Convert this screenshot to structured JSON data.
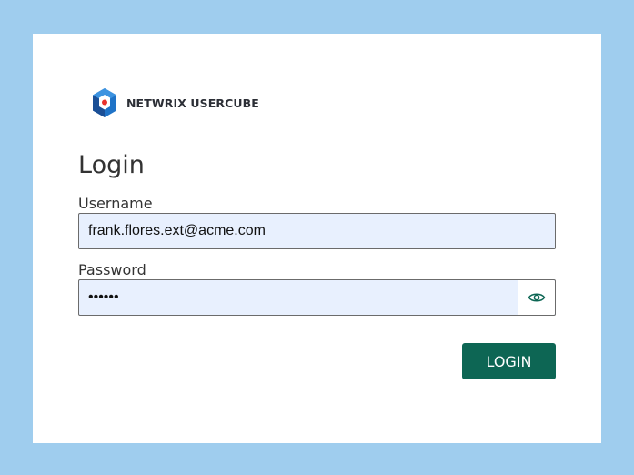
{
  "brand": {
    "name": "NETWRIX USERCUBE",
    "logo_icon": "netwrix-usercube-logo-icon",
    "colors": {
      "logo_blue": "#1f73c7",
      "logo_dark_blue": "#1b4f96",
      "logo_red": "#e8322c",
      "primary_button": "#0d6654",
      "background": "#9fcdee",
      "input_fill": "#e8f0fe"
    }
  },
  "form": {
    "title": "Login",
    "username": {
      "label": "Username",
      "value": "frank.flores.ext@acme.com"
    },
    "password": {
      "label": "Password",
      "value": "••••••",
      "toggle_icon": "eye-icon"
    },
    "submit_label": "LOGIN"
  }
}
